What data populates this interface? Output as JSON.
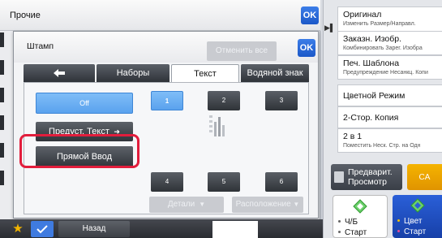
{
  "outer_dialog": {
    "title": "Прочие",
    "ok_label": "OK"
  },
  "stamp_dialog": {
    "title": "Штамп",
    "ok_label": "OK",
    "cancel_all_label": "Отменить все",
    "tabs": [
      {
        "label": "",
        "icon": "back-arrow-icon"
      },
      {
        "label": "Наборы"
      },
      {
        "label": "Текст",
        "active": true
      },
      {
        "label": "Водяной знак"
      }
    ],
    "off_label": "Off",
    "preset_text_label": "Предуст. Текст",
    "direct_input_label": "Прямой Ввод",
    "positions": [
      "1",
      "2",
      "3",
      "4",
      "5",
      "6"
    ],
    "selected_position": "1",
    "details_label": "Детали",
    "layout_label": "Расположение"
  },
  "right_panel": {
    "items": [
      {
        "main": "Оригинал",
        "sub": "Изменить Размер/Направл."
      },
      {
        "main": "Заказн. Изобр.",
        "sub": "Комбинировать Зарег. Изобра"
      },
      {
        "main": "Печ. Шаблона",
        "sub": "Предупреждение Несанкц. Копи"
      },
      {
        "main": "Цветной Режим",
        "sub": ""
      },
      {
        "main": "2-Стор. Копия",
        "sub": ""
      },
      {
        "main": "2 в 1",
        "sub": "Поместить Неск. Стр. на Одн"
      }
    ],
    "preview_label_1": "Предварит.",
    "preview_label_2": "Просмотр",
    "ca_label": "CA",
    "bw_label": "Ч/Б",
    "bw_start": "Старт",
    "color_label": "Цвет",
    "color_start": "Старт"
  },
  "bottom_bar": {
    "back_label": "Назад"
  },
  "colors": {
    "accent_blue": "#5aa2ee",
    "highlight_red": "#e21d3c",
    "ca_orange": "#f5b400",
    "start_green": "#4cc14c"
  }
}
